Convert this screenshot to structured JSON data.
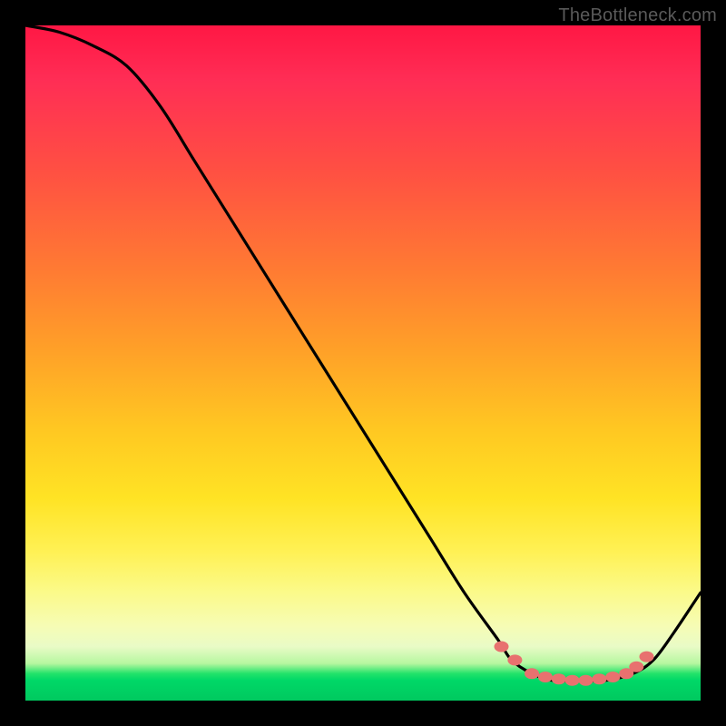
{
  "watermark": "TheBottleneck.com",
  "chart_data": {
    "type": "line",
    "title": "",
    "xlabel": "",
    "ylabel": "",
    "xlim": [
      0,
      100
    ],
    "ylim": [
      0,
      100
    ],
    "grid": false,
    "series": [
      {
        "name": "curve",
        "x": [
          0,
          5,
          10,
          15,
          20,
          25,
          30,
          35,
          40,
          45,
          50,
          55,
          60,
          65,
          70,
          72,
          75,
          78,
          82,
          86,
          90,
          93,
          96,
          100
        ],
        "values": [
          100,
          99,
          97,
          94,
          88,
          80,
          72,
          64,
          56,
          48,
          40,
          32,
          24,
          16,
          9,
          6,
          4,
          3,
          3,
          3,
          4,
          6,
          10,
          16
        ]
      }
    ],
    "markers": {
      "name": "highlight-points",
      "color": "#e8716f",
      "points": [
        {
          "x": 70.5,
          "y": 8
        },
        {
          "x": 72.5,
          "y": 6
        },
        {
          "x": 75,
          "y": 4
        },
        {
          "x": 77,
          "y": 3.5
        },
        {
          "x": 79,
          "y": 3.2
        },
        {
          "x": 81,
          "y": 3
        },
        {
          "x": 83,
          "y": 3
        },
        {
          "x": 85,
          "y": 3.2
        },
        {
          "x": 87,
          "y": 3.5
        },
        {
          "x": 89,
          "y": 4
        },
        {
          "x": 90.5,
          "y": 5
        },
        {
          "x": 92,
          "y": 6.5
        }
      ]
    },
    "background": {
      "type": "vertical-gradient",
      "stops": [
        {
          "pos": 0.0,
          "color": "#ff1744"
        },
        {
          "pos": 0.36,
          "color": "#ff7a33"
        },
        {
          "pos": 0.7,
          "color": "#ffe324"
        },
        {
          "pos": 0.92,
          "color": "#e9fbc6"
        },
        {
          "pos": 1.0,
          "color": "#00c95f"
        }
      ]
    }
  }
}
